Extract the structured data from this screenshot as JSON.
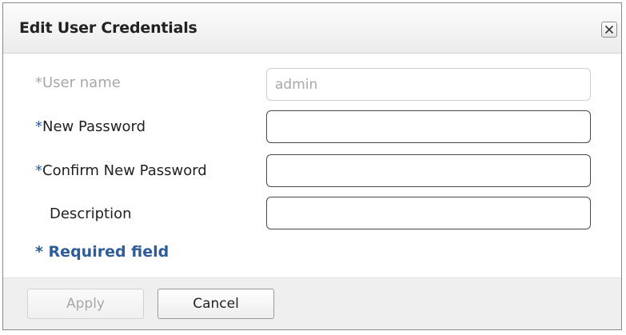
{
  "dialog": {
    "title": "Edit User Credentials",
    "close_label": "Close"
  },
  "form": {
    "required_marker": "*",
    "username": {
      "label": "User name",
      "value": "admin",
      "disabled": true
    },
    "new_password": {
      "label": "New Password",
      "value": ""
    },
    "confirm_password": {
      "label": "Confirm New Password",
      "value": ""
    },
    "description": {
      "label": "Description",
      "value": ""
    },
    "required_note": "* Required field"
  },
  "footer": {
    "apply_label": "Apply",
    "apply_disabled": true,
    "cancel_label": "Cancel"
  },
  "colors": {
    "accent": "#2c5d9a",
    "disabled_text": "#a8a8a8",
    "footer_bg": "#efefef"
  }
}
